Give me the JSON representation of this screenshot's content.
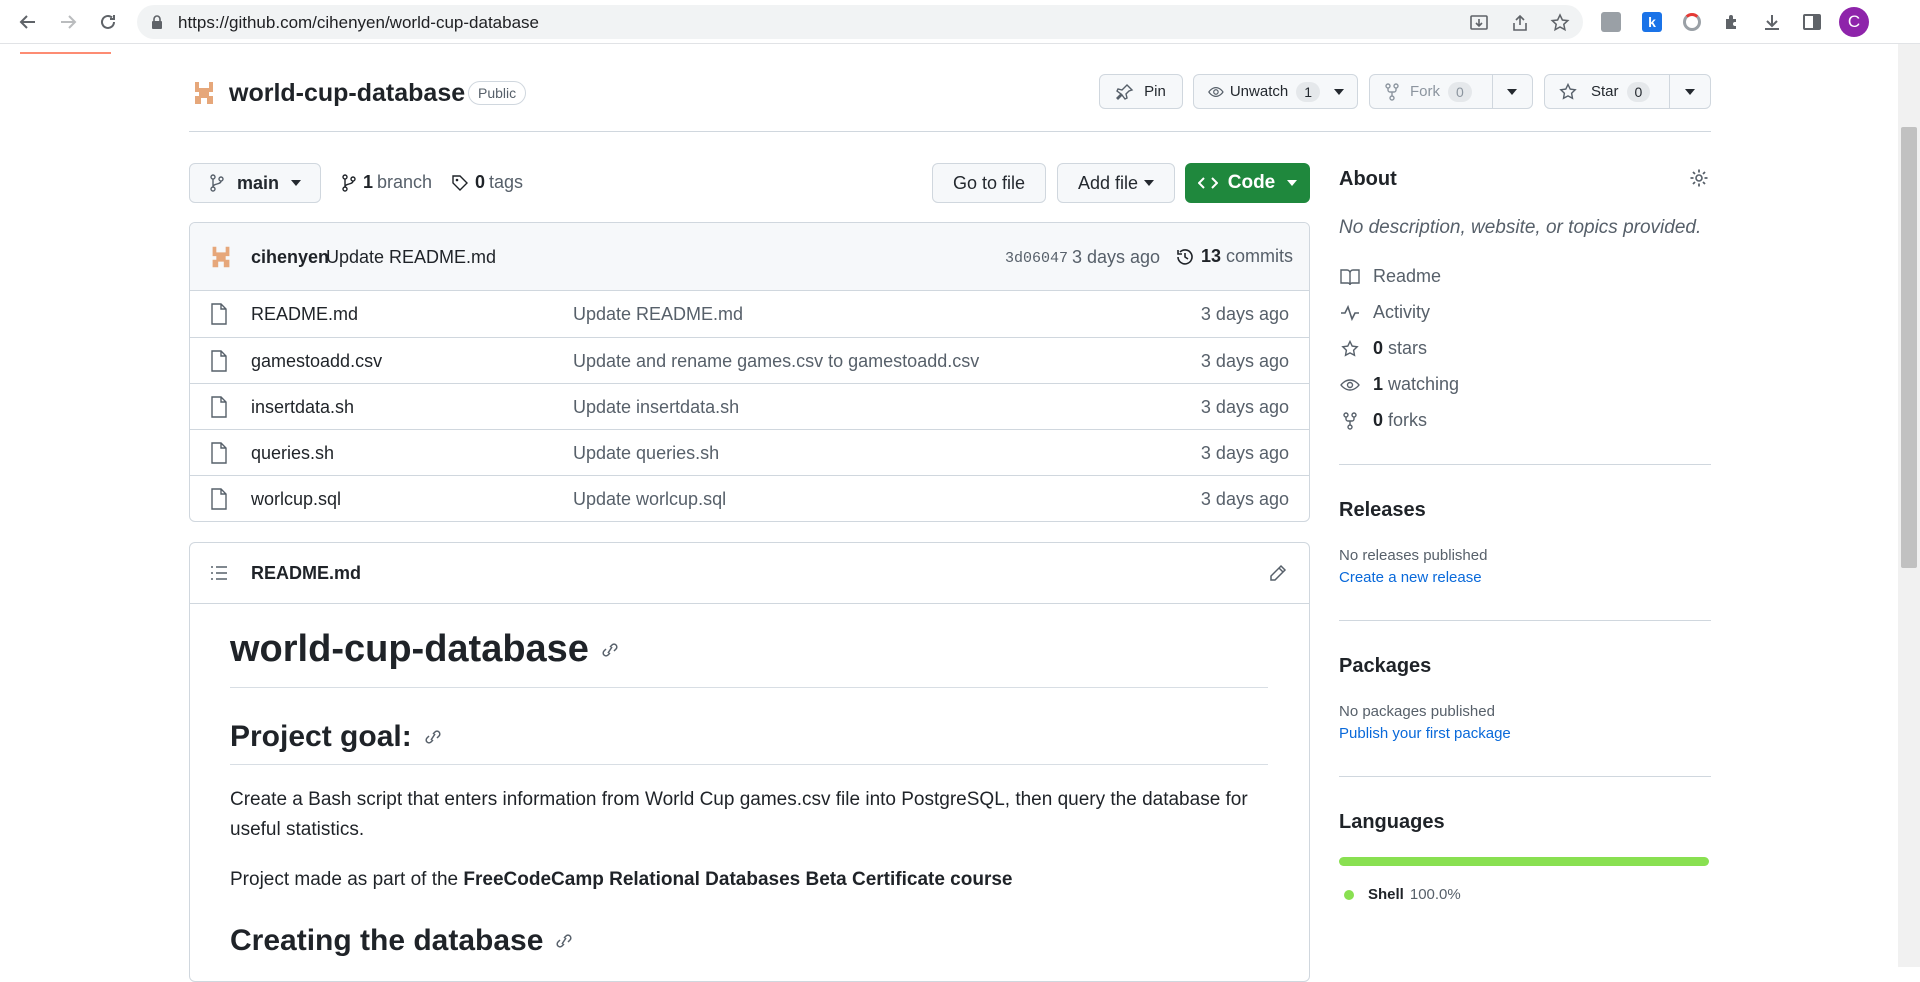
{
  "browser": {
    "url": "https://github.com/cihenyen/world-cup-database",
    "avatar_letter": "C",
    "avatar_color": "#8e24aa"
  },
  "repo": {
    "name": "world-cup-database",
    "visibility": "Public",
    "pin_label": "Pin",
    "unwatch_label": "Unwatch",
    "unwatch_count": "1",
    "fork_label": "Fork",
    "fork_count": "0",
    "star_label": "Star",
    "star_count": "0"
  },
  "toolbar": {
    "branch": "main",
    "branch_count": "1",
    "branch_label": "branch",
    "tag_count": "0",
    "tag_label": "tags",
    "go_to_file": "Go to file",
    "add_file": "Add file",
    "code": "Code"
  },
  "commit": {
    "author": "cihenyen",
    "message": "Update README.md",
    "sha": "3d06047",
    "age": "3 days ago",
    "commit_count": "13",
    "commits_label": "commits"
  },
  "files": [
    {
      "name": "README.md",
      "message": "Update README.md",
      "age": "3 days ago"
    },
    {
      "name": "gamestoadd.csv",
      "message": "Update and rename games.csv to gamestoadd.csv",
      "age": "3 days ago"
    },
    {
      "name": "insertdata.sh",
      "message": "Update insertdata.sh",
      "age": "3 days ago"
    },
    {
      "name": "queries.sh",
      "message": "Update queries.sh",
      "age": "3 days ago"
    },
    {
      "name": "worlcup.sql",
      "message": "Update worlcup.sql",
      "age": "3 days ago"
    }
  ],
  "readme": {
    "file_name": "README.md",
    "h1": "world-cup-database",
    "h2_goal": "Project goal:",
    "p1": "Create a Bash script that enters information from World Cup games.csv file into PostgreSQL, then query the database for useful statistics.",
    "p2_prefix": "Project made as part of the ",
    "p2_bold": "FreeCodeCamp Relational Databases Beta Certificate course",
    "h2_creating": "Creating the database"
  },
  "sidebar": {
    "about_title": "About",
    "about_desc": "No description, website, or topics provided.",
    "readme_label": "Readme",
    "activity_label": "Activity",
    "stars_count": "0",
    "stars_label": "stars",
    "watching_count": "1",
    "watching_label": "watching",
    "forks_count": "0",
    "forks_label": "forks",
    "releases_title": "Releases",
    "releases_none": "No releases published",
    "releases_link": "Create a new release",
    "packages_title": "Packages",
    "packages_none": "No packages published",
    "packages_link": "Publish your first package",
    "languages_title": "Languages",
    "language_name": "Shell",
    "language_pct": "100.0%",
    "language_color": "#89e051"
  }
}
